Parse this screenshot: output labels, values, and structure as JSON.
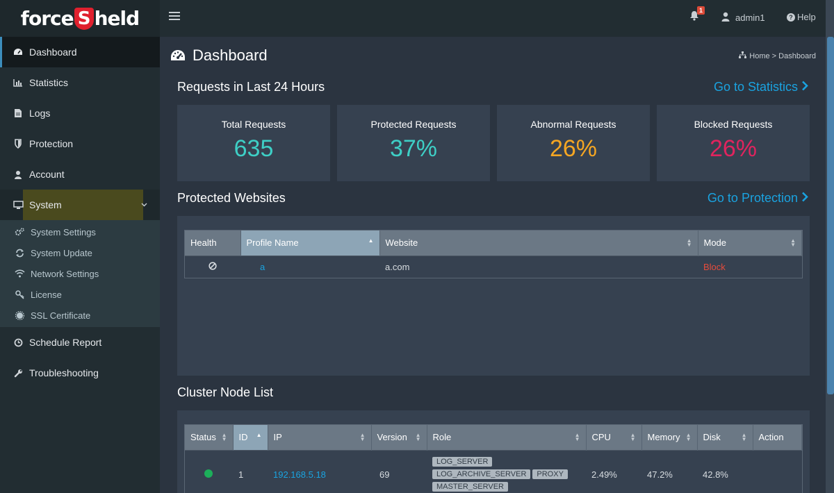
{
  "brand": {
    "name": "ForceShield",
    "logo_left": "force",
    "logo_mid": "S",
    "logo_right": "held"
  },
  "colors": {
    "teal": "#3ecfc6",
    "orange": "#f5a623",
    "pink": "#e0245e",
    "link": "#1aa3e0",
    "block": "#e74c3c",
    "online": "#1caf5a"
  },
  "header": {
    "notifications": "1",
    "user": "admin1",
    "help": "Help"
  },
  "sidebar": {
    "items": [
      {
        "label": "Dashboard",
        "icon": "dashboard-icon"
      },
      {
        "label": "Statistics",
        "icon": "bar-chart-icon"
      },
      {
        "label": "Logs",
        "icon": "file-icon"
      },
      {
        "label": "Protection",
        "icon": "shield-icon"
      },
      {
        "label": "Account",
        "icon": "user-icon"
      },
      {
        "label": "System",
        "icon": "monitor-icon"
      }
    ],
    "system_sub": [
      {
        "label": "System Settings",
        "icon": "gears-icon"
      },
      {
        "label": "System Update",
        "icon": "refresh-icon"
      },
      {
        "label": "Network Settings",
        "icon": "wifi-icon"
      },
      {
        "label": "License",
        "icon": "key-icon"
      },
      {
        "label": "SSL Certificate",
        "icon": "certificate-icon"
      }
    ],
    "bottom": [
      {
        "label": "Schedule Report",
        "icon": "clock-icon"
      },
      {
        "label": "Troubleshooting",
        "icon": "wrench-icon"
      }
    ]
  },
  "page": {
    "title": "Dashboard",
    "breadcrumb": {
      "home": "Home",
      "sep": ">",
      "current": "Dashboard"
    }
  },
  "requests": {
    "title": "Requests in Last 24 Hours",
    "link": "Go to Statistics",
    "cards": [
      {
        "label": "Total Requests",
        "value": "635"
      },
      {
        "label": "Protected Requests",
        "value": "37%"
      },
      {
        "label": "Abnormal Requests",
        "value": "26%"
      },
      {
        "label": "Blocked Requests",
        "value": "26%"
      }
    ]
  },
  "websites": {
    "title": "Protected Websites",
    "link": "Go to Protection",
    "columns": [
      "Health",
      "Profile Name",
      "Website",
      "Mode"
    ],
    "rows": [
      {
        "profile": "a",
        "website": "a.com",
        "mode": "Block"
      }
    ]
  },
  "cluster": {
    "title": "Cluster Node List",
    "columns": [
      "Status",
      "ID",
      "IP",
      "Version",
      "Role",
      "CPU",
      "Memory",
      "Disk",
      "Action"
    ],
    "rows": [
      {
        "id": "1",
        "ip": "192.168.5.18",
        "version": "69",
        "roles": [
          "LOG_SERVER",
          "LOG_ARCHIVE_SERVER",
          "PROXY",
          "MASTER_SERVER"
        ],
        "cpu": "2.49%",
        "memory": "47.2%",
        "disk": "42.8%"
      }
    ]
  }
}
